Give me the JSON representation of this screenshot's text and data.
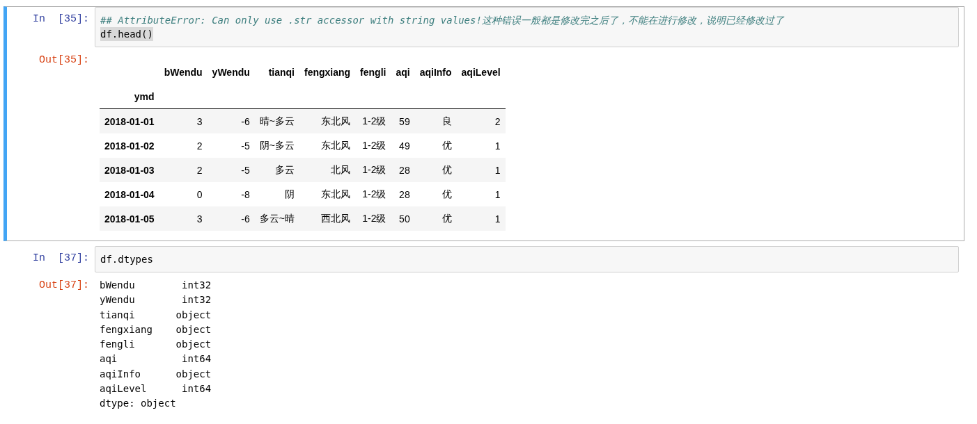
{
  "cells": [
    {
      "prompt_in": "In  [35]:",
      "selected": true,
      "code_lines": [
        {
          "kind": "comment",
          "text": "## AttributeError: Can only use .str accessor with string values!这种错误一般都是修改完之后了，不能在进行修改，说明已经修改过了",
          "highlighted": false
        },
        {
          "kind": "code",
          "text": "df.head()",
          "highlighted": true
        }
      ],
      "prompt_out": "Out[35]:",
      "output": {
        "kind": "dataframe",
        "columns": [
          "bWendu",
          "yWendu",
          "tianqi",
          "fengxiang",
          "fengli",
          "aqi",
          "aqiInfo",
          "aqiLevel"
        ],
        "index_name": "ymd",
        "rows": [
          {
            "index": "2018-01-01",
            "cells": [
              "3",
              "-6",
              "晴~多云",
              "东北风",
              "1-2级",
              "59",
              "良",
              "2"
            ]
          },
          {
            "index": "2018-01-02",
            "cells": [
              "2",
              "-5",
              "阴~多云",
              "东北风",
              "1-2级",
              "49",
              "优",
              "1"
            ]
          },
          {
            "index": "2018-01-03",
            "cells": [
              "2",
              "-5",
              "多云",
              "北风",
              "1-2级",
              "28",
              "优",
              "1"
            ]
          },
          {
            "index": "2018-01-04",
            "cells": [
              "0",
              "-8",
              "阴",
              "东北风",
              "1-2级",
              "28",
              "优",
              "1"
            ]
          },
          {
            "index": "2018-01-05",
            "cells": [
              "3",
              "-6",
              "多云~晴",
              "西北风",
              "1-2级",
              "50",
              "优",
              "1"
            ]
          }
        ]
      }
    },
    {
      "prompt_in": "In  [37]:",
      "selected": false,
      "code_lines": [
        {
          "kind": "code",
          "text": "df.dtypes",
          "highlighted": false
        }
      ],
      "prompt_out": "Out[37]:",
      "output": {
        "kind": "text",
        "lines": [
          "bWendu        int32",
          "yWendu        int32",
          "tianqi       object",
          "fengxiang    object",
          "fengli       object",
          "aqi           int64",
          "aqiInfo      object",
          "aqiLevel      int64",
          "dtype: object"
        ]
      }
    }
  ]
}
